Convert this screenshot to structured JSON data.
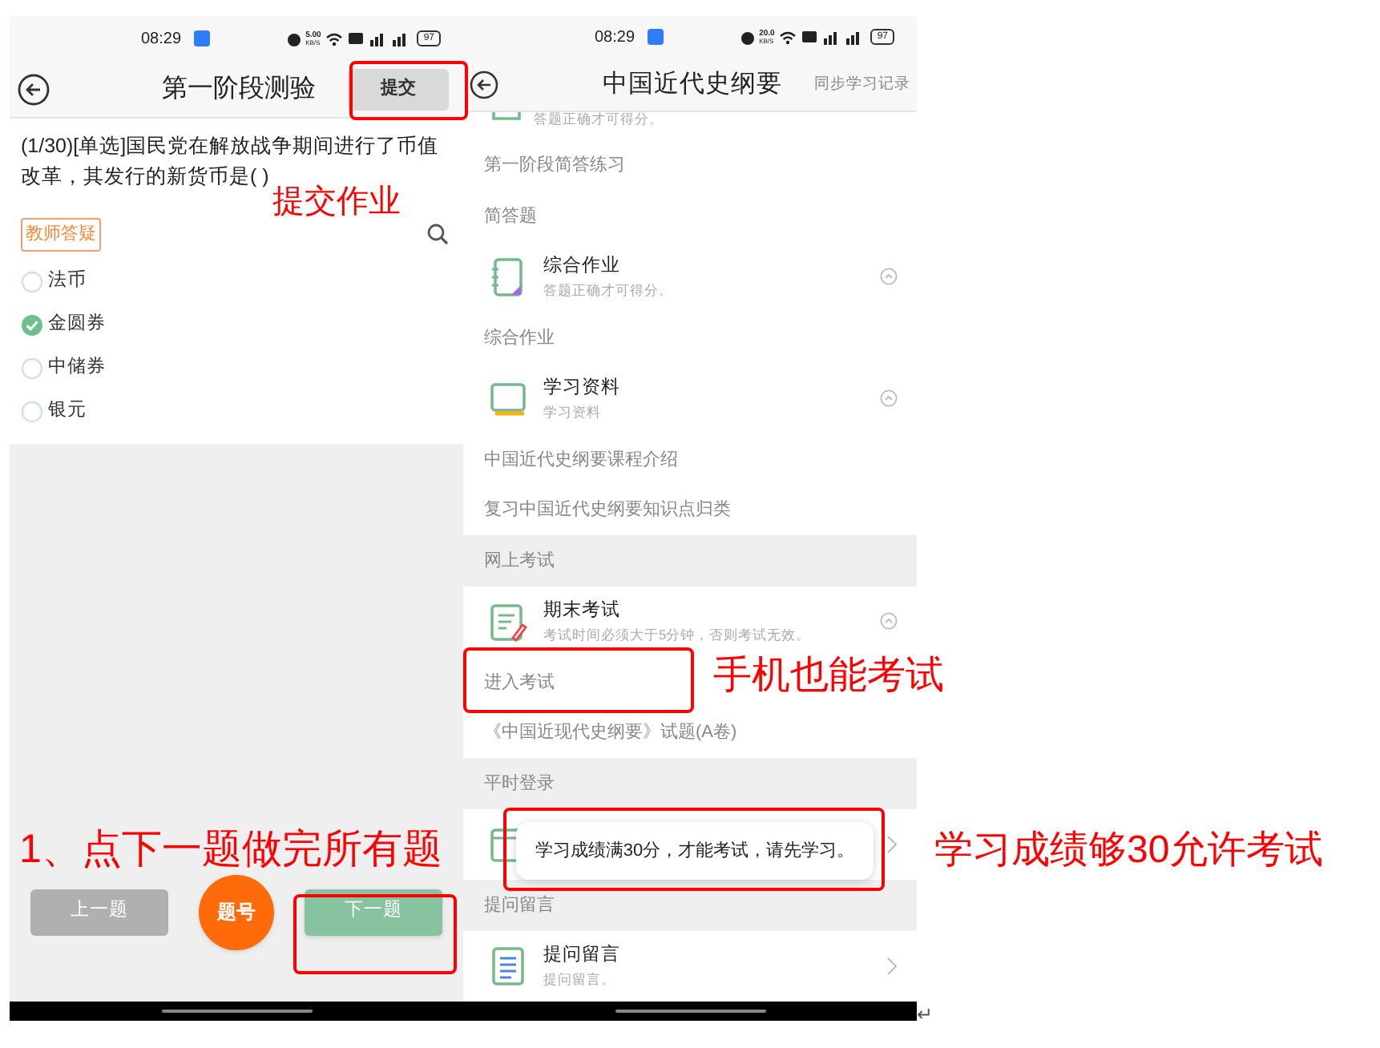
{
  "left_phone": {
    "status_bar": {
      "time": "08:29",
      "speed": "5.00",
      "speed_unit": "KB/S",
      "battery": "97"
    },
    "title": "第一阶段测验",
    "submit_button": "提交",
    "question": "(1/30)[单选]国民党在解放战争期间进行了币值改革，其发行的新货币是( )",
    "teacher_tag": "教师答疑",
    "options": [
      {
        "label": "法币",
        "selected": false
      },
      {
        "label": "金圆券",
        "selected": true
      },
      {
        "label": "中储券",
        "selected": false
      },
      {
        "label": "银元",
        "selected": false
      }
    ],
    "footer": {
      "prev_button": {
        "label": "上一题",
        "disabled": true
      },
      "number_button": "题号",
      "next_button": "下一题"
    }
  },
  "right_phone": {
    "status_bar": {
      "time": "08:29",
      "speed": "20.0",
      "speed_unit": "KB/S",
      "battery": "97"
    },
    "title": "中国近代史纲要",
    "sync_link": "同步学习记录",
    "rows": [
      {
        "kind": "partial",
        "subtitle": "答题正确才可得分。"
      },
      {
        "kind": "link",
        "text": "第一阶段简答练习"
      },
      {
        "kind": "heading",
        "text": "简答题"
      },
      {
        "kind": "card",
        "title": "综合作业",
        "subtitle": "答题正确才可得分。",
        "expanded": true
      },
      {
        "kind": "heading",
        "text": "综合作业"
      },
      {
        "kind": "card",
        "title": "学习资料",
        "subtitle": "学习资料",
        "expanded": true
      },
      {
        "kind": "link",
        "text": "中国近代史纲要课程介绍"
      },
      {
        "kind": "link",
        "text": "复习中国近代史纲要知识点归类"
      },
      {
        "kind": "section",
        "text": "网上考试"
      },
      {
        "kind": "card",
        "title": "期末考试",
        "subtitle": "考试时间必须大于5分钟，否则考试无效。",
        "expanded": true
      },
      {
        "kind": "link",
        "text": "进入考试"
      },
      {
        "kind": "link",
        "text": "《中国近现代史纲要》试题(A卷)"
      },
      {
        "kind": "section",
        "text": "平时登录"
      },
      {
        "kind": "card",
        "expanded": false
      },
      {
        "kind": "section",
        "text": "提问留言"
      },
      {
        "kind": "card",
        "title": "提问留言",
        "subtitle": "提问留言。",
        "expanded": false
      }
    ],
    "toast": "学习成绩满30分，才能考试，请先学习。"
  },
  "annotations": [
    "提交作业",
    "手机也能考试",
    "1、点下一题做完所有题",
    "学习成绩够30允许考试"
  ],
  "end_mark": "↵"
}
